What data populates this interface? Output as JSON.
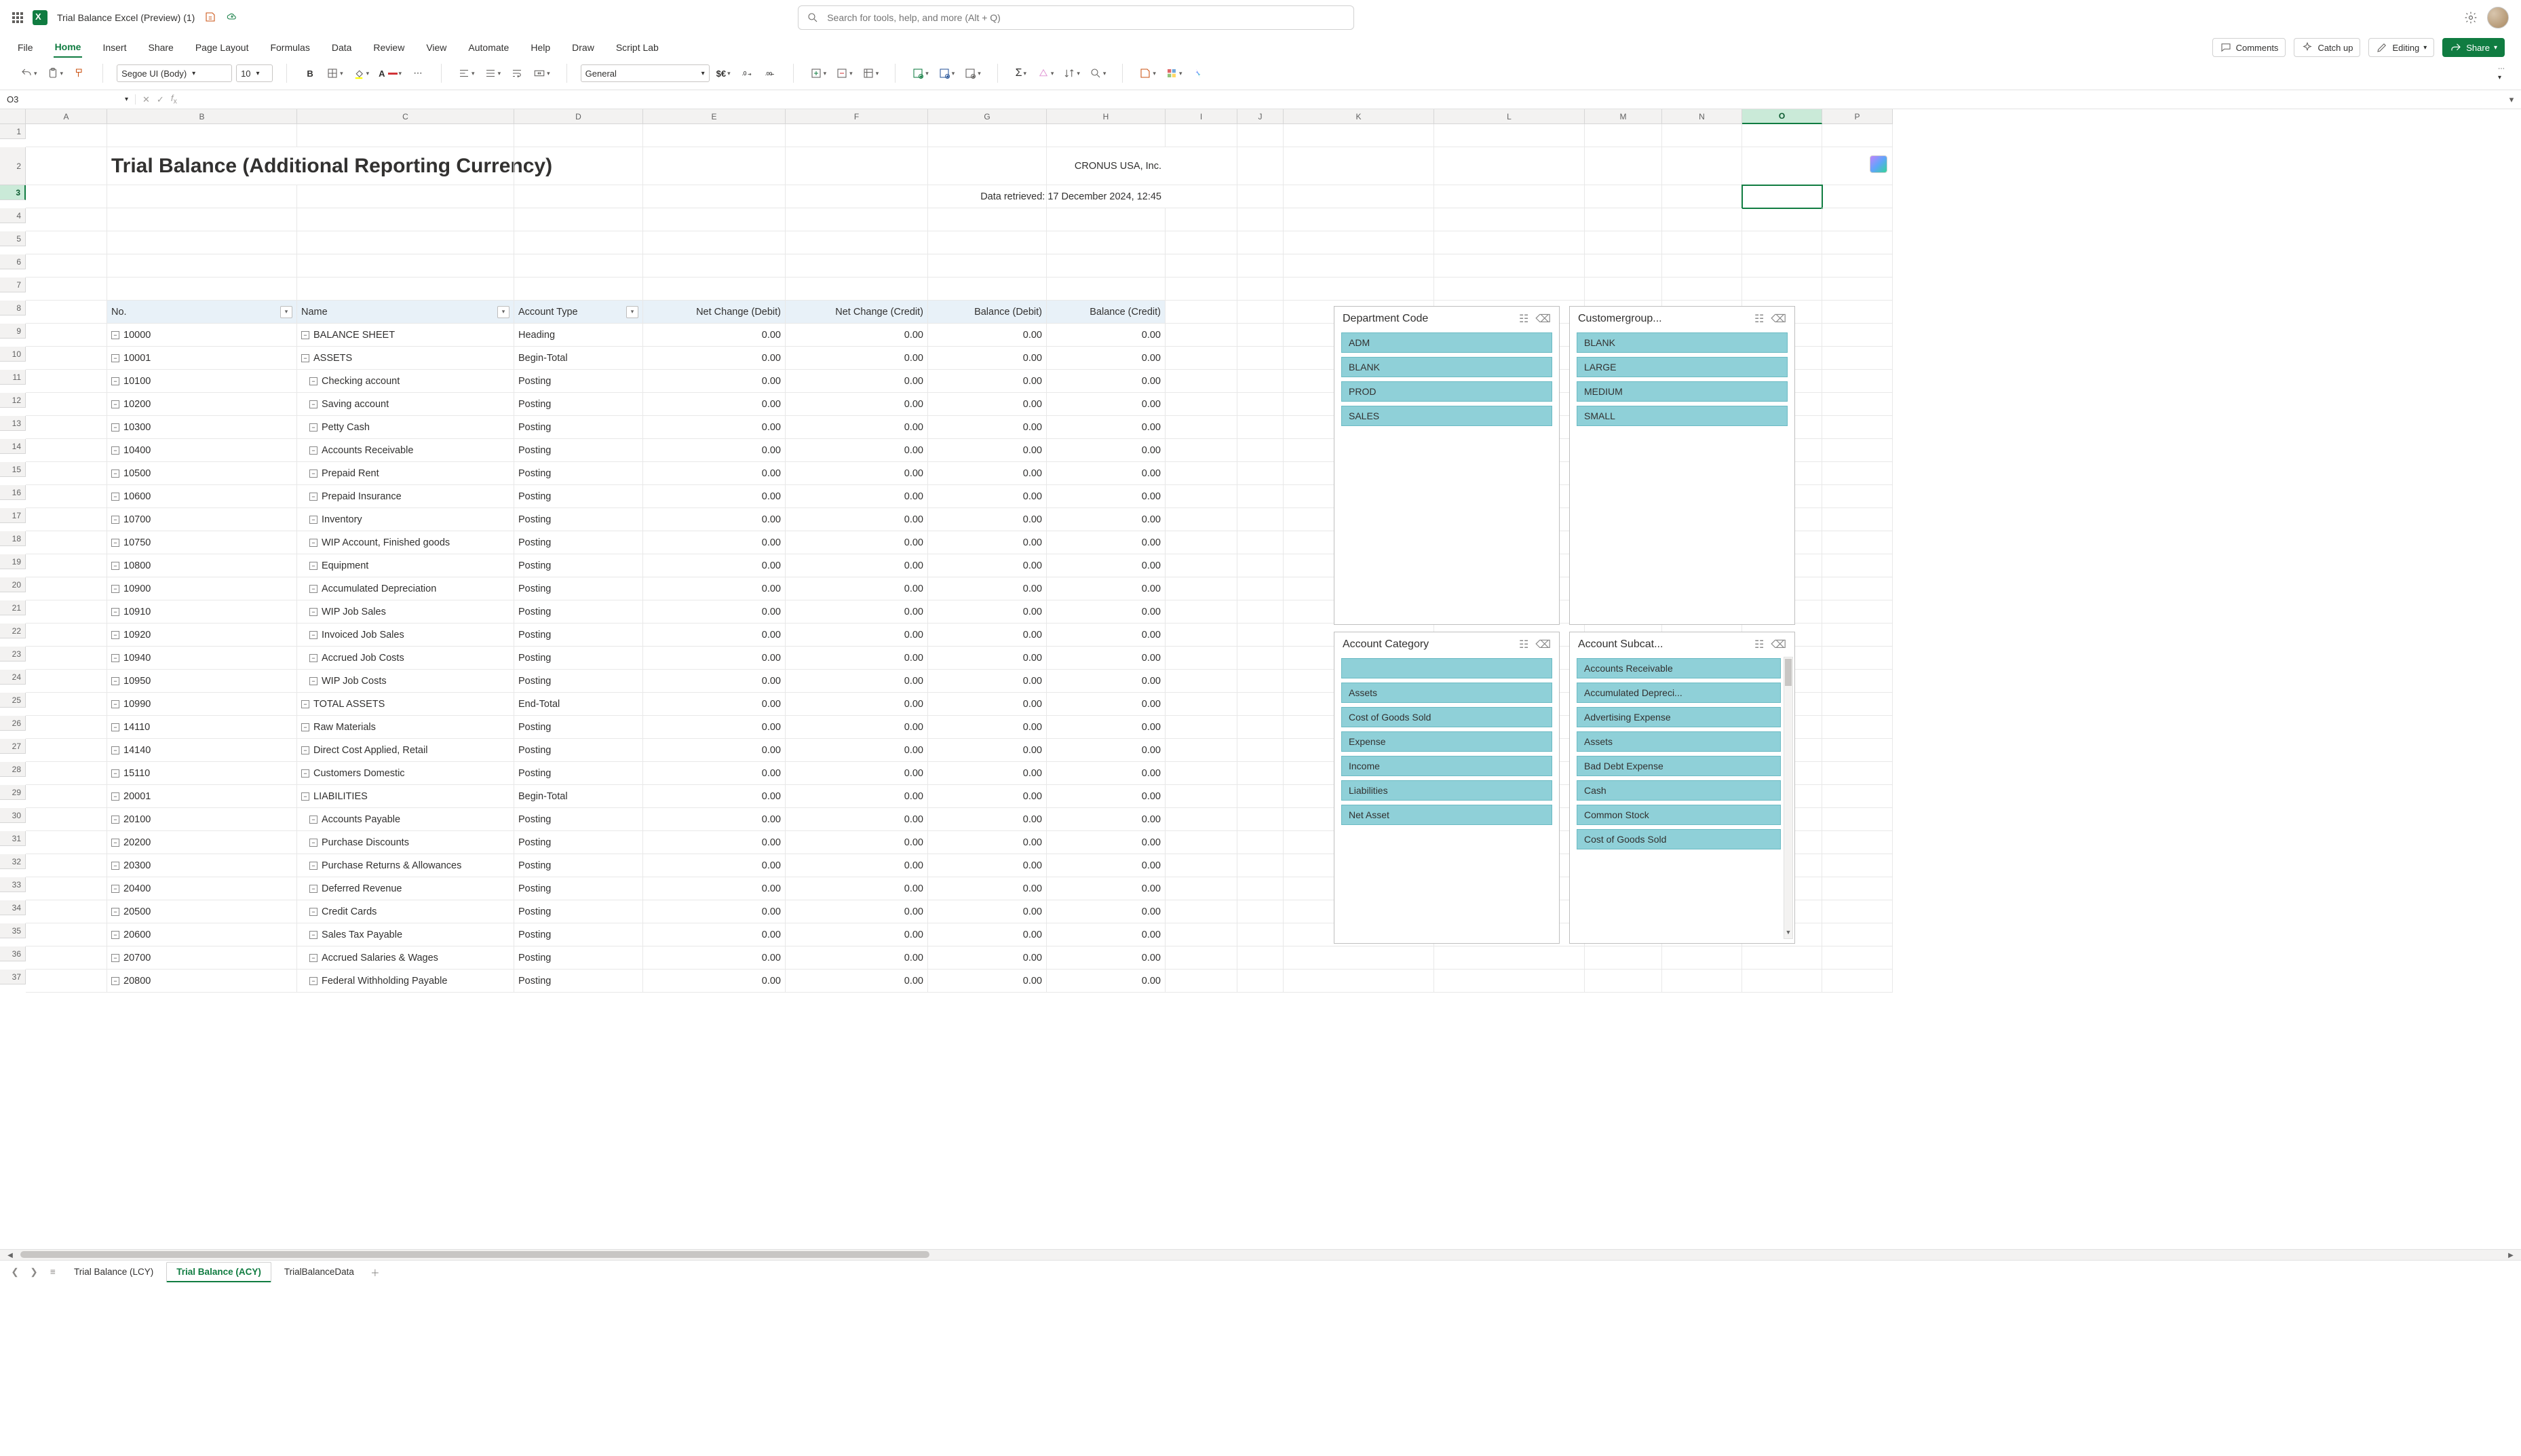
{
  "window": {
    "title": "Trial Balance Excel (Preview) (1)"
  },
  "search": {
    "placeholder": "Search for tools, help, and more (Alt + Q)"
  },
  "menu": {
    "tabs": [
      "File",
      "Home",
      "Insert",
      "Share",
      "Page Layout",
      "Formulas",
      "Data",
      "Review",
      "View",
      "Automate",
      "Help",
      "Draw",
      "Script Lab"
    ],
    "active": 1,
    "comments": "Comments",
    "catchup": "Catch up",
    "editing": "Editing",
    "share": "Share"
  },
  "ribbon": {
    "font_name": "Segoe UI (Body)",
    "font_size": "10",
    "number_format": "General"
  },
  "namebox": "O3",
  "formula": "",
  "columns": [
    "A",
    "B",
    "C",
    "D",
    "E",
    "F",
    "G",
    "H",
    "I",
    "J",
    "K",
    "L",
    "M",
    "N",
    "O",
    "P"
  ],
  "selected_col_index": 14,
  "selected_row": 3,
  "report": {
    "title": "Trial Balance (Additional Reporting Currency)",
    "company": "CRONUS USA, Inc.",
    "retrieved": "Data retrieved: 17 December 2024, 12:45"
  },
  "table": {
    "headers": {
      "no": "No.",
      "name": "Name",
      "account_type": "Account Type",
      "nc_debit": "Net Change (Debit)",
      "nc_credit": "Net Change (Credit)",
      "bal_debit": "Balance (Debit)",
      "bal_credit": "Balance (Credit)"
    },
    "rows": [
      {
        "r": 9,
        "no": "10000",
        "name": "BALANCE SHEET",
        "type": "Heading",
        "indent": 0
      },
      {
        "r": 10,
        "no": "10001",
        "name": "ASSETS",
        "type": "Begin-Total",
        "indent": 0
      },
      {
        "r": 11,
        "no": "10100",
        "name": "Checking account",
        "type": "Posting",
        "indent": 1
      },
      {
        "r": 12,
        "no": "10200",
        "name": "Saving account",
        "type": "Posting",
        "indent": 1
      },
      {
        "r": 13,
        "no": "10300",
        "name": "Petty Cash",
        "type": "Posting",
        "indent": 1
      },
      {
        "r": 14,
        "no": "10400",
        "name": "Accounts Receivable",
        "type": "Posting",
        "indent": 1
      },
      {
        "r": 15,
        "no": "10500",
        "name": "Prepaid Rent",
        "type": "Posting",
        "indent": 1
      },
      {
        "r": 16,
        "no": "10600",
        "name": "Prepaid Insurance",
        "type": "Posting",
        "indent": 1
      },
      {
        "r": 17,
        "no": "10700",
        "name": "Inventory",
        "type": "Posting",
        "indent": 1
      },
      {
        "r": 18,
        "no": "10750",
        "name": "WIP Account, Finished goods",
        "type": "Posting",
        "indent": 1
      },
      {
        "r": 19,
        "no": "10800",
        "name": "Equipment",
        "type": "Posting",
        "indent": 1
      },
      {
        "r": 20,
        "no": "10900",
        "name": "Accumulated Depreciation",
        "type": "Posting",
        "indent": 1
      },
      {
        "r": 21,
        "no": "10910",
        "name": "WIP Job Sales",
        "type": "Posting",
        "indent": 1
      },
      {
        "r": 22,
        "no": "10920",
        "name": "Invoiced Job Sales",
        "type": "Posting",
        "indent": 1
      },
      {
        "r": 23,
        "no": "10940",
        "name": "Accrued Job Costs",
        "type": "Posting",
        "indent": 1
      },
      {
        "r": 24,
        "no": "10950",
        "name": "WIP Job Costs",
        "type": "Posting",
        "indent": 1
      },
      {
        "r": 25,
        "no": "10990",
        "name": "TOTAL ASSETS",
        "type": "End-Total",
        "indent": 0
      },
      {
        "r": 26,
        "no": "14110",
        "name": "Raw Materials",
        "type": "Posting",
        "indent": 0
      },
      {
        "r": 27,
        "no": "14140",
        "name": "Direct Cost Applied, Retail",
        "type": "Posting",
        "indent": 0
      },
      {
        "r": 28,
        "no": "15110",
        "name": "Customers Domestic",
        "type": "Posting",
        "indent": 0
      },
      {
        "r": 29,
        "no": "20001",
        "name": "LIABILITIES",
        "type": "Begin-Total",
        "indent": 0
      },
      {
        "r": 30,
        "no": "20100",
        "name": "Accounts Payable",
        "type": "Posting",
        "indent": 1
      },
      {
        "r": 31,
        "no": "20200",
        "name": "Purchase Discounts",
        "type": "Posting",
        "indent": 1
      },
      {
        "r": 32,
        "no": "20300",
        "name": "Purchase Returns & Allowances",
        "type": "Posting",
        "indent": 1
      },
      {
        "r": 33,
        "no": "20400",
        "name": "Deferred Revenue",
        "type": "Posting",
        "indent": 1
      },
      {
        "r": 34,
        "no": "20500",
        "name": "Credit Cards",
        "type": "Posting",
        "indent": 1
      },
      {
        "r": 35,
        "no": "20600",
        "name": "Sales Tax Payable",
        "type": "Posting",
        "indent": 1
      },
      {
        "r": 36,
        "no": "20700",
        "name": "Accrued Salaries & Wages",
        "type": "Posting",
        "indent": 1
      },
      {
        "r": 37,
        "no": "20800",
        "name": "Federal Withholding Payable",
        "type": "Posting",
        "indent": 1
      }
    ],
    "zero": "0.00"
  },
  "slicers": {
    "dept": {
      "title": "Department Code",
      "items": [
        "ADM",
        "BLANK",
        "PROD",
        "SALES"
      ]
    },
    "cust": {
      "title": "Customergroup...",
      "items": [
        "BLANK",
        "LARGE",
        "MEDIUM",
        "SMALL"
      ]
    },
    "acccat": {
      "title": "Account Category",
      "items": [
        "",
        "Assets",
        "Cost of Goods Sold",
        "Expense",
        "Income",
        "Liabilities",
        "Net Asset"
      ]
    },
    "accsub": {
      "title": "Account Subcat...",
      "items": [
        "Accounts Receivable",
        "Accumulated Depreci...",
        "Advertising Expense",
        "Assets",
        "Bad Debt Expense",
        "Cash",
        "Common Stock",
        "Cost of Goods Sold"
      ]
    }
  },
  "sheets": {
    "tabs": [
      "Trial Balance (LCY)",
      "Trial Balance (ACY)",
      "TrialBalanceData"
    ],
    "active": 1
  }
}
